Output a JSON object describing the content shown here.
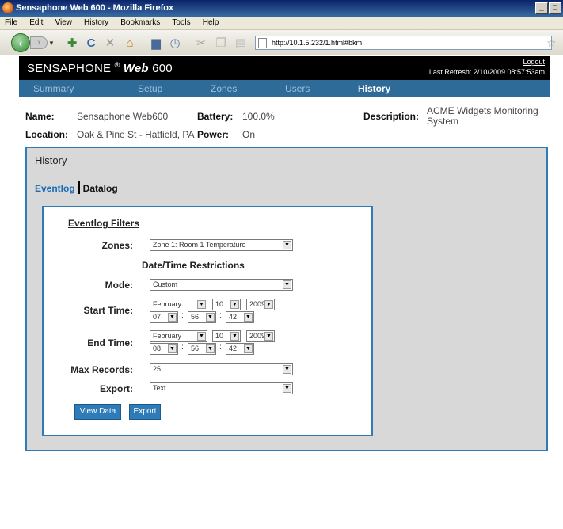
{
  "browser": {
    "window_title": "Sensaphone Web 600 - Mozilla Firefox",
    "menu": [
      "File",
      "Edit",
      "View",
      "History",
      "Bookmarks",
      "Tools",
      "Help"
    ],
    "url": "http://10.1.5.232/1.html#bkm",
    "icons": [
      "back-arrow-icon",
      "forward-arrow-icon",
      "bookmark-add-icon",
      "reload-icon",
      "stop-icon",
      "home-icon",
      "print-icon",
      "history-icon",
      "cut-icon",
      "copy-icon",
      "paste-icon",
      "page-icon",
      "star-icon"
    ]
  },
  "header": {
    "brand_main": "SENSAPHONE",
    "brand_reg": "®",
    "brand_web": "Web",
    "brand_model": "600",
    "logout": "Logout",
    "last_refresh": "Last Refresh: 2/10/2009 08:57:53am"
  },
  "nav": {
    "items": [
      {
        "label": "Summary",
        "active": false
      },
      {
        "label": "Setup",
        "active": false
      },
      {
        "label": "Zones",
        "active": false
      },
      {
        "label": "Users",
        "active": false
      },
      {
        "label": "History",
        "active": true
      }
    ]
  },
  "device": {
    "name_label": "Name:",
    "name": "Sensaphone Web600",
    "location_label": "Location:",
    "location": "Oak & Pine St - Hatfield, PA",
    "battery_label": "Battery:",
    "battery": "100.0%",
    "power_label": "Power:",
    "power": "On",
    "description_label": "Description:",
    "description_line1": "ACME Widgets Monitoring",
    "description_line2": "System"
  },
  "history": {
    "title": "History",
    "tab_eventlog": "Eventlog",
    "tab_datalog": "Datalog",
    "filters": {
      "title": "Eventlog Filters",
      "zones_label": "Zones:",
      "zones_value": "Zone 1: Room 1 Temperature",
      "datetime_heading": "Date/Time Restrictions",
      "mode_label": "Mode:",
      "mode_value": "Custom",
      "start_label": "Start Time:",
      "start": {
        "month": "February",
        "day": "10",
        "year": "2009",
        "hour": "07",
        "minute": "56",
        "second": "42"
      },
      "end_label": "End Time:",
      "end": {
        "month": "February",
        "day": "10",
        "year": "2009",
        "hour": "08",
        "minute": "56",
        "second": "42"
      },
      "max_label": "Max Records:",
      "max_value": "25",
      "export_label": "Export:",
      "export_value": "Text",
      "view_button": "View Data",
      "export_button": "Export"
    }
  },
  "colors": {
    "accent_blue": "#2f7bb8",
    "nav_bar": "#2f6b98",
    "header_black": "#000000",
    "panel_gray": "#d8d8d8"
  }
}
